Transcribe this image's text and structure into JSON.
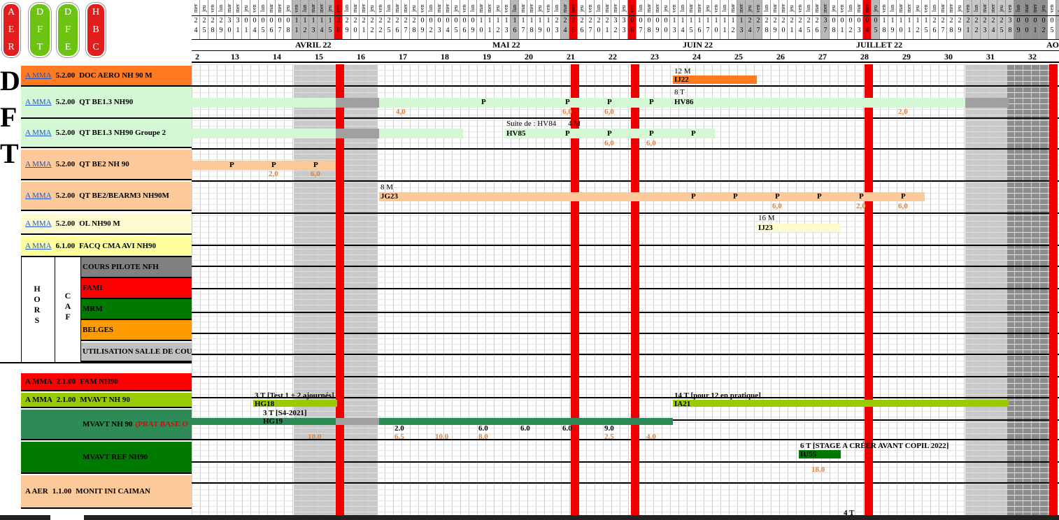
{
  "badges": [
    {
      "letters": [
        "A",
        "E",
        "R"
      ],
      "color": "#e11d1d"
    },
    {
      "letters": [
        "D",
        "F",
        "T"
      ],
      "color": "#6cc312"
    },
    {
      "letters": [
        "D",
        "F",
        "E"
      ],
      "color": "#6cc312"
    },
    {
      "letters": [
        "H",
        "B",
        "C"
      ],
      "color": "#e11d1d"
    }
  ],
  "big_letters": [
    "D",
    "F",
    "T"
  ],
  "months": [
    "AVRIL 22",
    "MAI 22",
    "JUIN 22",
    "JUILLET 22",
    "AO"
  ],
  "weeks": [
    "2",
    "13",
    "14",
    "15",
    "16",
    "17",
    "18",
    "19",
    "20",
    "21",
    "22",
    "23",
    "24",
    "25",
    "26",
    "27",
    "28",
    "29",
    "30",
    "31",
    "32"
  ],
  "day_letters": [
    "mer",
    "jeu",
    "ven",
    "lun",
    "mar"
  ],
  "tens_digits": "222233000000111112222222222000000011111111122222223300000111111111222222222300000011111122222222230000000111112",
  "units_digits": "458901145678123458901225678923456901236789034567012367890345670123478901456781234589012567891234589012534567890",
  "hors": "HORS",
  "caf": "CAF",
  "rows": [
    {
      "org": "A MMA",
      "code": "5.2.00",
      "name": "DOC AERO NH 90 M",
      "bg": "#ff7a1e"
    },
    {
      "org": "A MMA",
      "code": "5.2.00",
      "name": "QT BE1.3 NH90",
      "bg": "#d3f8d3"
    },
    {
      "org": "A MMA",
      "code": "5.2.00",
      "name": "QT BE1.3 NH90 Groupe 2",
      "bg": "#d3f8d3"
    },
    {
      "org": "A MMA",
      "code": "5.2.00",
      "name": "QT BE2 NH 90",
      "bg": "#fcc99a"
    },
    {
      "org": "A MMA",
      "code": "5.2.00",
      "name": "QT BE2/BEARM3 NH90M",
      "bg": "#fcc99a"
    },
    {
      "org": "A MMA",
      "code": "5.2.00",
      "name": "OL NH90 M",
      "bg": "#fffbd0"
    },
    {
      "org": "A MMA",
      "code": "6.1.00",
      "name": "FACQ CMA AVI NH90",
      "bg": "#ffff9c"
    }
  ],
  "hors_rows": [
    {
      "name": "COURS PILOTE NFH",
      "bg": "#808080"
    },
    {
      "name": "FAMI",
      "bg": "#ff0000"
    },
    {
      "name": "MRM",
      "bg": "#007a00"
    },
    {
      "name": "BELGES",
      "bg": "#ff9a00"
    },
    {
      "name": "UTILISATION SALLE DE COU",
      "bg": "#c0c0c0"
    }
  ],
  "rows2": [
    {
      "org": "A MMA",
      "code": "2.1.00",
      "name": "FAM NH90",
      "bg": "#ff0000",
      "extra": ""
    },
    {
      "org": "A MMA",
      "code": "2.1.00",
      "name": "MVAVT NH 90",
      "bg": "#99cc00",
      "extra": ""
    },
    {
      "org": "",
      "code": "",
      "name": "MVAVT NH 90",
      "bg": "#2e8b57",
      "extra": "(PRAT BASE O"
    },
    {
      "org": "",
      "code": "",
      "name": "MVAVT REF NH90",
      "bg": "#007a00",
      "extra": ""
    },
    {
      "org": "A AER",
      "code": "1.1.00",
      "name": "MONIT INI CAIMAN",
      "bg": "#fcc99a",
      "extra": ""
    }
  ],
  "notes": {
    "doc_aero_count": "12 M",
    "doc_aero_code": "IJ22",
    "qt13_count": "8 T",
    "qt13_code": "HV86",
    "qt13g2_suite": "Suite de : HV84",
    "qt13g2_count": "4 M",
    "qt13g2_code": "HV85",
    "be2arm_count": "8 M",
    "be2arm_code": "JG23",
    "ol_count": "16 M",
    "ol_code": "IJ23",
    "mvavt_a": "3 T [Test 1 + 2 ajournés]",
    "mvavt_a_code": "HG18",
    "mvavt_b": "14 T [pour 12 en pratique]",
    "mvavt_b_code": "IA21",
    "prat_a": "3 T [S4-2021]",
    "prat_a_code": "HG19",
    "ref_note": "6 T [STAGE A CRÉER AVANT COPIL 2022]",
    "ref_code": "IU55",
    "ref_hours": "18.0",
    "bottom_count": "4 T",
    "p": "P"
  },
  "numbers": {
    "qt13": [
      "4,0",
      "6,0",
      "6,0",
      "2,0"
    ],
    "qt13g2": [
      "6,0",
      "6,0"
    ],
    "be2": [
      "2,0",
      "6,0"
    ],
    "be2arm": [
      "6,0",
      "2,0",
      "6,0"
    ],
    "prat_black": [
      "2.0",
      "6.0",
      "6.0",
      "6.0",
      "9.0"
    ],
    "prat_orange": [
      "10.0",
      "6.5",
      "10.0",
      "8.0",
      "2.5",
      "4.0"
    ]
  }
}
